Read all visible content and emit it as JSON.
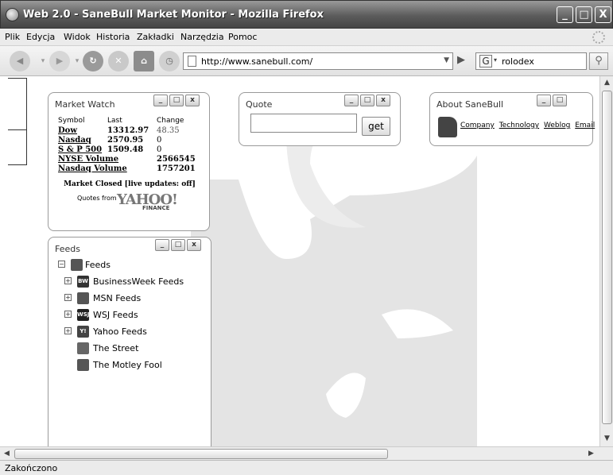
{
  "window": {
    "title": "Web 2.0 - SaneBull Market Monitor - Mozilla Firefox",
    "minimize": "_",
    "maximize": "□",
    "close": "X"
  },
  "menubar": [
    "Plik",
    "Edycja",
    "Widok",
    "Historia",
    "Zakładki",
    "Narzędzia",
    "Pomoc"
  ],
  "toolbar": {
    "url": "http://www.sanebull.com/",
    "search_engine": "G",
    "search_value": "rolodex"
  },
  "market_watch": {
    "title": "Market Watch",
    "headers": [
      "Symbol",
      "Last",
      "Change"
    ],
    "rows": [
      {
        "symbol": "Dow",
        "last": "13312.97",
        "change": "48.35"
      },
      {
        "symbol": "Nasdaq",
        "last": "2570.95",
        "change": "0"
      },
      {
        "symbol": "S & P 500",
        "last": "1509.48",
        "change": "0"
      }
    ],
    "volumes": [
      {
        "label": "NYSE Volume",
        "value": "2566545"
      },
      {
        "label": "Nasdaq Volume",
        "value": "1757201"
      }
    ],
    "status": "Market Closed [live updates: off]",
    "quotes_from": "Quotes from",
    "provider_logo": "YAHOO!",
    "provider_sub": "FINANCE"
  },
  "quote": {
    "title": "Quote",
    "button": "get",
    "value": ""
  },
  "about": {
    "title": "About SaneBull",
    "links": [
      "Company",
      "Technology",
      "Weblog",
      "Email"
    ]
  },
  "feeds": {
    "title": "Feeds",
    "root": "Feeds",
    "items": [
      {
        "label": "BusinessWeek Feeds",
        "icon": "businessweek-icon",
        "badge": "BW",
        "color": "#333333",
        "expandable": true
      },
      {
        "label": "MSN Feeds",
        "icon": "msn-butterfly-icon",
        "badge": "",
        "color": "#555555",
        "expandable": true
      },
      {
        "label": "WSJ Feeds",
        "icon": "wsj-icon",
        "badge": "WSJ",
        "color": "#222222",
        "expandable": true
      },
      {
        "label": "Yahoo Feeds",
        "icon": "yahoo-icon",
        "badge": "Y!",
        "color": "#444444",
        "expandable": true
      },
      {
        "label": "The Street",
        "icon": "thestreet-icon",
        "badge": "",
        "color": "#666666",
        "expandable": false
      },
      {
        "label": "The Motley Fool",
        "icon": "motley-fool-icon",
        "badge": "",
        "color": "#555555",
        "expandable": false
      }
    ]
  },
  "statusbar": {
    "text": "Zakończono"
  },
  "colors": {
    "titlebar": "#5c5c5c",
    "widget_border": "#9a9a9a",
    "bull": "#e4e4e4"
  }
}
